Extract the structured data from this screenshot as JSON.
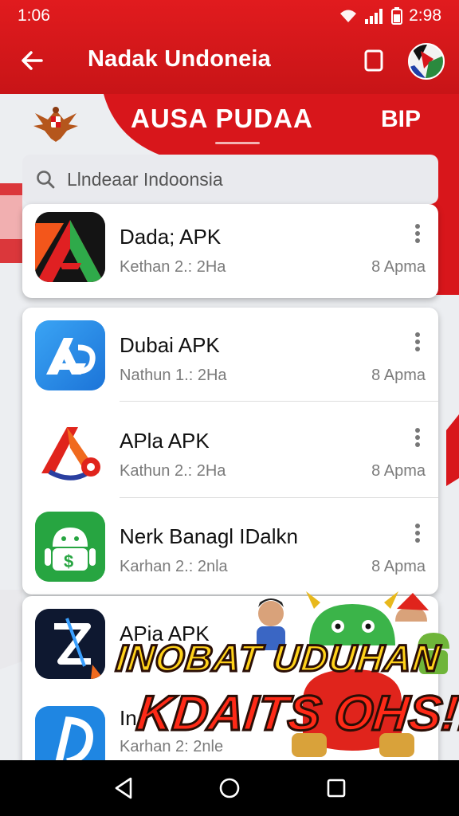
{
  "status_bar": {
    "time": "1:06",
    "battery_time": "2:98"
  },
  "app_bar": {
    "title": "Nadak Undoneia"
  },
  "tabs": {
    "main": "AUSA PUDAA",
    "secondary": "BIP"
  },
  "search": {
    "placeholder": "Llndeaar Indoonsia"
  },
  "apps": [
    {
      "name": "Dada; APK",
      "subtitle": "Kethan 2.: 2Ha",
      "meta": "8 Apma",
      "icon": "red-a-app-icon"
    },
    {
      "name": "Dubai APK",
      "subtitle": "Nathun 1.: 2Ha",
      "meta": "8 Apma",
      "icon": "blue-a-app-icon"
    },
    {
      "name": "APla APK",
      "subtitle": "Kathun 2.: 2Ha",
      "meta": "8 Apma",
      "icon": "triangle-a-app-icon"
    },
    {
      "name": "Nerk Banagl IDalkn",
      "subtitle": "Karhan 2.: 2nla",
      "meta": "8 Apma",
      "icon": "green-android-app-icon"
    },
    {
      "name": "APia APK",
      "subtitle": "",
      "meta": "",
      "icon": "dark-z-app-icon"
    },
    {
      "name": "In",
      "subtitle": "Karhan 2: 2nle",
      "meta": "",
      "icon": "blue-d-app-icon"
    }
  ],
  "promo": {
    "line1": "INOBAT UDUHAN",
    "line2": "KDAITS OHS!!"
  },
  "colors": {
    "primary_red": "#d8161b",
    "card_bg": "#ffffff",
    "promo_yellow": "#ffd21a",
    "promo_red": "#ff2a17"
  }
}
